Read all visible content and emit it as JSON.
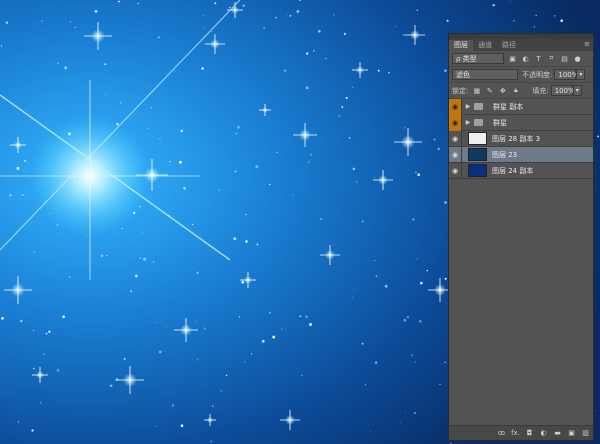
{
  "canvas": {
    "description": "starfield"
  },
  "panel": {
    "tabs": [
      {
        "label": "图层",
        "active": true
      },
      {
        "label": "通道",
        "active": false
      },
      {
        "label": "路径",
        "active": false
      }
    ],
    "filter": {
      "kind_label": "ρ 类型"
    },
    "blend": {
      "mode": "滤色",
      "opacity_label": "不透明度:",
      "opacity_value": "100%"
    },
    "lock": {
      "label": "锁定:",
      "fill_label": "填充:",
      "fill_value": "100%"
    },
    "layers": [
      {
        "name": "群星 副本",
        "type": "group",
        "visible": true,
        "highlighted": true,
        "selected": false
      },
      {
        "name": "群星",
        "type": "group",
        "visible": true,
        "highlighted": true,
        "selected": false
      },
      {
        "name": "图层 28 副本 3",
        "type": "layer",
        "visible": true,
        "highlighted": false,
        "selected": false
      },
      {
        "name": "图层 23",
        "type": "layer",
        "visible": true,
        "highlighted": false,
        "selected": true
      },
      {
        "name": "图层 24 副本",
        "type": "layer",
        "visible": true,
        "highlighted": false,
        "selected": false
      }
    ],
    "bottom_icons": [
      "link-icon",
      "fx-icon",
      "mask-icon",
      "adjustment-icon",
      "folder-icon",
      "new-layer-icon",
      "trash-icon"
    ],
    "bottom_labels": {
      "link": "ꝏ",
      "fx": "fx.",
      "mask": "◘",
      "adjust": "◐",
      "folder": "▬",
      "new": "▣",
      "trash": "▥"
    }
  }
}
